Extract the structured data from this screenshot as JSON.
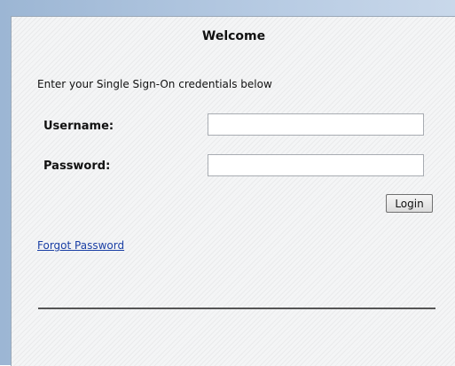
{
  "dialog": {
    "title": "Welcome",
    "instructions": "Enter your Single Sign-On credentials below"
  },
  "form": {
    "username_label": "Username:",
    "username_value": "",
    "password_label": "Password:",
    "password_value": "",
    "login_label": "Login"
  },
  "links": {
    "forgot_password": "Forgot Password"
  },
  "colors": {
    "link": "#1a3fa5",
    "frame_blue": "#9cb6d4"
  }
}
